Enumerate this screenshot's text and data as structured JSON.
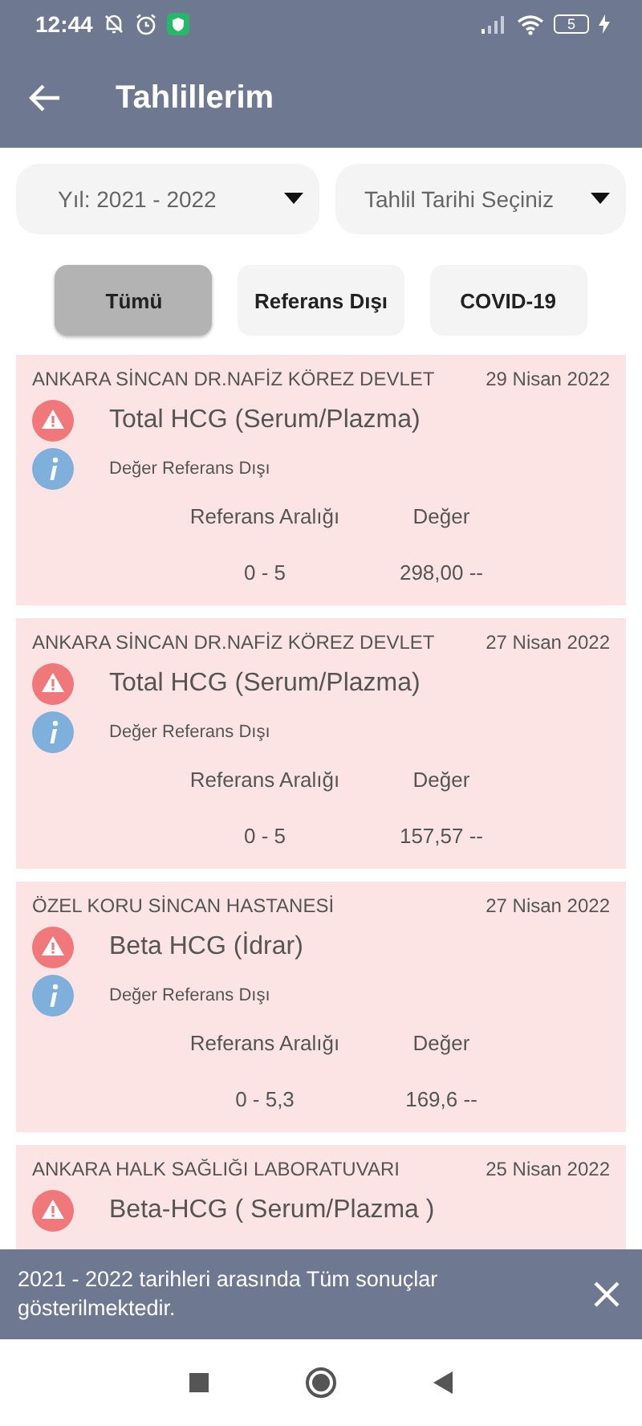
{
  "status_bar": {
    "time": "12:44",
    "battery": "5"
  },
  "app_bar": {
    "title": "Tahlillerim"
  },
  "dropdowns": [
    {
      "value": "Yıl: 2021 - 2022"
    },
    {
      "value": "Tahlil Tarihi Seçiniz"
    }
  ],
  "filters": [
    {
      "label": "Tümü",
      "selected": true
    },
    {
      "label": "Referans Dışı",
      "selected": false
    },
    {
      "label": "COVID-19",
      "selected": false
    }
  ],
  "results": [
    {
      "institution": "ANKARA SİNCAN DR.NAFİZ KÖREZ DEVLET",
      "date": "29 Nisan 2022",
      "test": "Total HCG (Serum/Plazma)",
      "note": "Değer Referans Dışı",
      "range_label": "Referans Aralığı",
      "value_label": "Değer",
      "range": "0 - 5",
      "value": "298,00 --"
    },
    {
      "institution": "ANKARA SİNCAN DR.NAFİZ KÖREZ DEVLET",
      "date": "27 Nisan 2022",
      "test": "Total HCG (Serum/Plazma)",
      "note": "Değer Referans Dışı",
      "range_label": "Referans Aralığı",
      "value_label": "Değer",
      "range": "0 - 5",
      "value": "157,57 --"
    },
    {
      "institution": "ÖZEL KORU SİNCAN HASTANESİ",
      "date": "27 Nisan 2022",
      "test": "Beta HCG (İdrar)",
      "note": "Değer Referans Dışı",
      "range_label": "Referans Aralığı",
      "value_label": "Değer",
      "range": "0 - 5,3",
      "value": "169,6 --"
    },
    {
      "institution": "ANKARA HALK SAĞLIĞI LABORATUVARI",
      "date": "25 Nisan 2022",
      "test": "Beta-HCG ( Serum/Plazma )"
    }
  ],
  "snackbar": {
    "message": "2021 - 2022 tarihleri arasında Tüm sonuçlar gösterilmektedir."
  }
}
